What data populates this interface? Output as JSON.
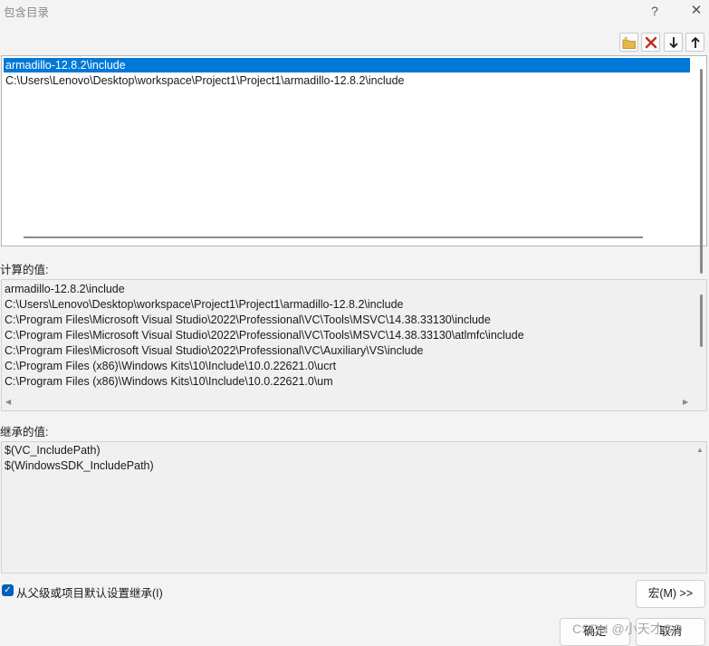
{
  "window": {
    "title": "包含目录",
    "help_label": "?",
    "close_label": "✕"
  },
  "toolbar": {
    "new_line_icon": "new-folder-icon",
    "delete_icon": "delete-x-icon",
    "move_down_icon": "arrow-down-icon",
    "move_up_icon": "arrow-up-icon",
    "accent": "#0078d7"
  },
  "list": {
    "items": [
      "armadillo-12.8.2\\include",
      "C:\\Users\\Lenovo\\Desktop\\workspace\\Project1\\Project1\\armadillo-12.8.2\\include"
    ]
  },
  "evaluated": {
    "label": "计算的值:",
    "lines": [
      "armadillo-12.8.2\\include",
      "C:\\Users\\Lenovo\\Desktop\\workspace\\Project1\\Project1\\armadillo-12.8.2\\include",
      "C:\\Program Files\\Microsoft Visual Studio\\2022\\Professional\\VC\\Tools\\MSVC\\14.38.33130\\include",
      "C:\\Program Files\\Microsoft Visual Studio\\2022\\Professional\\VC\\Tools\\MSVC\\14.38.33130\\atlmfc\\include",
      "C:\\Program Files\\Microsoft Visual Studio\\2022\\Professional\\VC\\Auxiliary\\VS\\include",
      "C:\\Program Files (x86)\\Windows Kits\\10\\Include\\10.0.22621.0\\ucrt",
      "C:\\Program Files (x86)\\Windows Kits\\10\\Include\\10.0.22621.0\\um"
    ]
  },
  "inherited": {
    "label": "继承的值:",
    "lines": [
      "$(VC_IncludePath)",
      "$(WindowsSDK_IncludePath)"
    ]
  },
  "inherit_checkbox": {
    "checked": true,
    "label": "从父级或项目默认设置继承(I)"
  },
  "buttons": {
    "macro": "宏(M) >>",
    "ok": "确定",
    "cancel": "取消"
  },
  "watermark": "CSDN @小天才GO"
}
